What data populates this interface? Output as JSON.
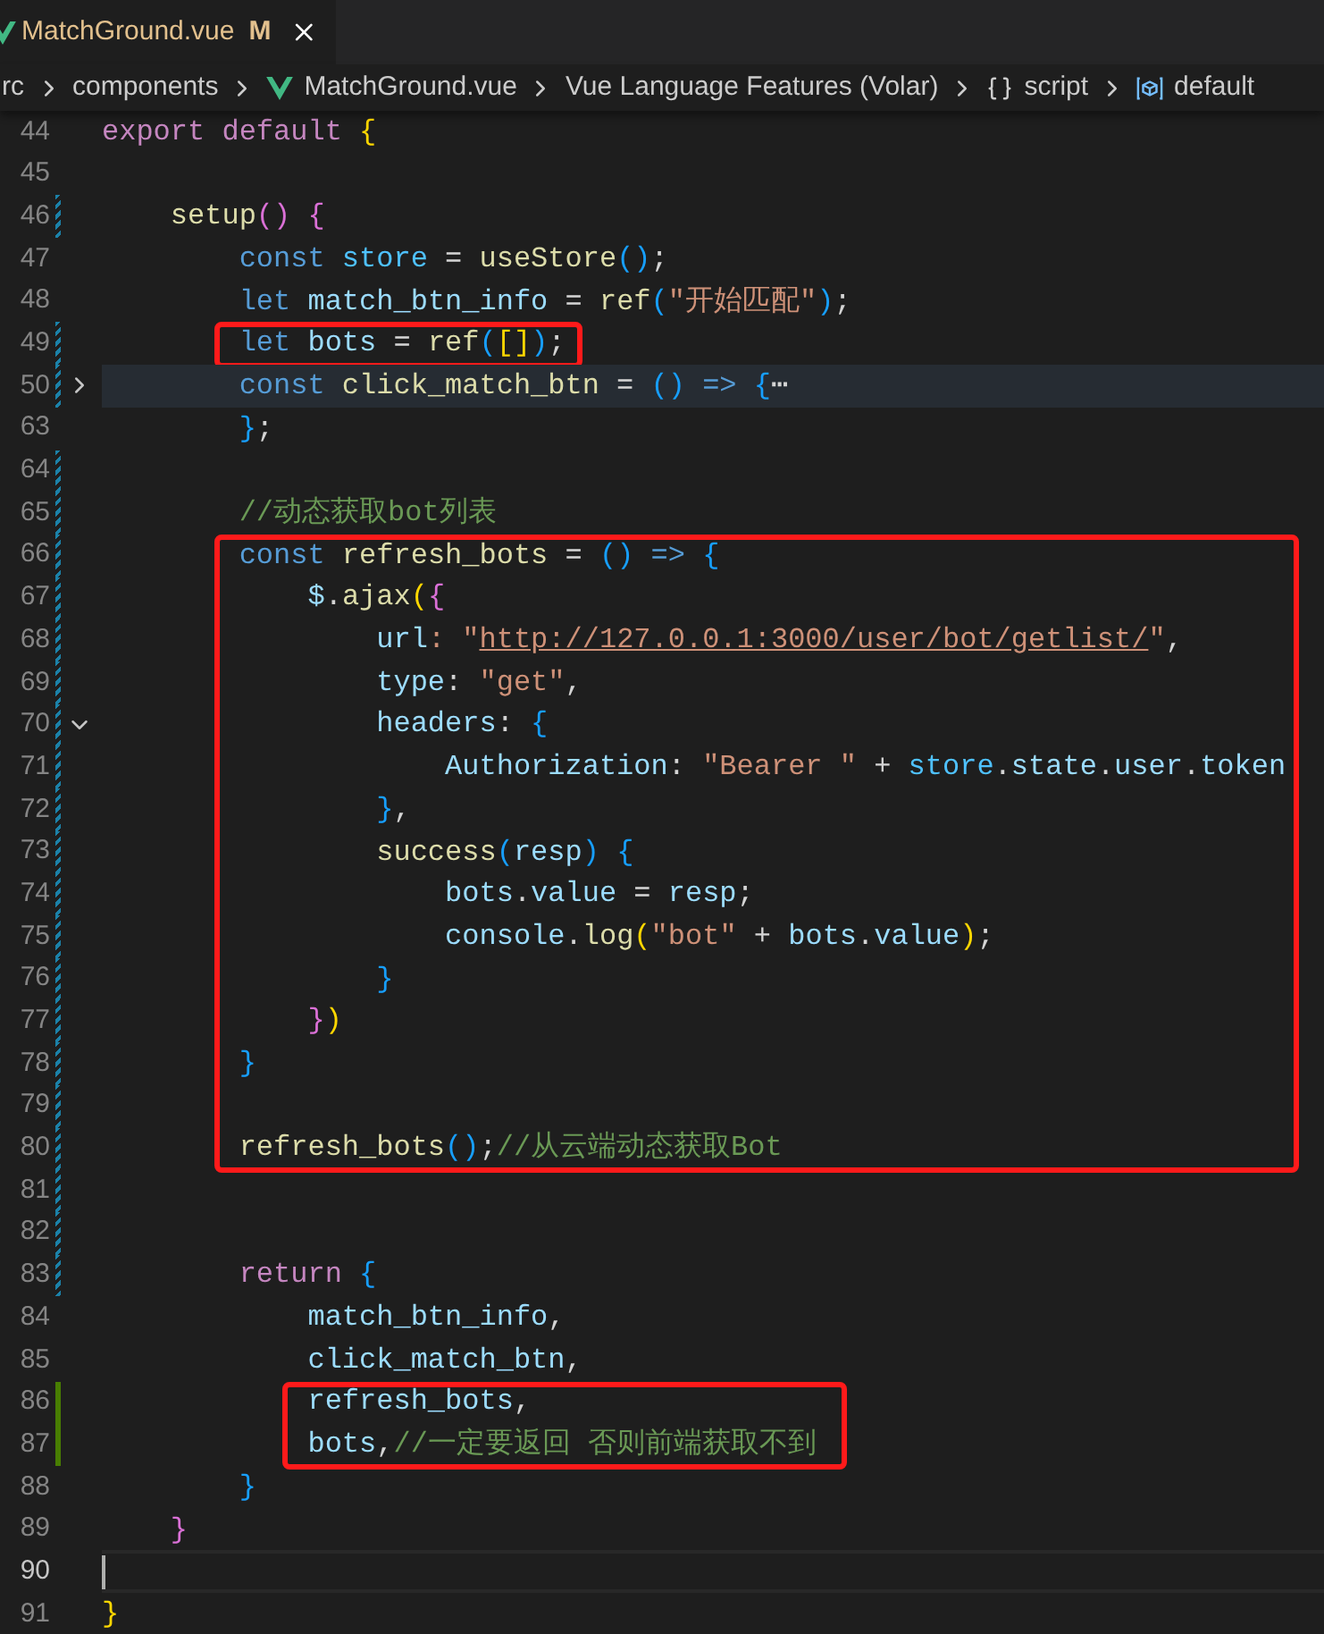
{
  "tab": {
    "filename": "MatchGround.vue",
    "status": "M"
  },
  "breadcrumbs": [
    {
      "label": "rc",
      "kind": "folder"
    },
    {
      "label": "components",
      "kind": "folder"
    },
    {
      "label": "MatchGround.vue",
      "kind": "vue"
    },
    {
      "label": "Vue Language Features (Volar)",
      "kind": "plain"
    },
    {
      "label": "script",
      "kind": "braces"
    },
    {
      "label": "default",
      "kind": "module"
    }
  ],
  "blocks": [
    {
      "boxed": false,
      "lines": [
        {
          "number": "44",
          "current": false,
          "kind": "plain",
          "tokens": [
            {
              "text": "export default ",
              "kind": "ctrl"
            },
            {
              "text": "{",
              "kind": "b1"
            }
          ]
        },
        {
          "number": "45",
          "current": false,
          "kind": "plain"
        },
        {
          "number": "46",
          "current": false,
          "kind": "modified",
          "tokens": [
            {
              "text": "    setup",
              "kind": "fn"
            },
            {
              "text": "()",
              "kind": "b2"
            },
            {
              "text": " {",
              "kind": "b2"
            }
          ]
        },
        {
          "number": "47",
          "current": false,
          "kind": "plain",
          "tokens": [
            {
              "text": "        const",
              "kind": "kw"
            },
            {
              "text": " store",
              "kind": "const"
            },
            {
              "text": " = ",
              "kind": "plain"
            },
            {
              "text": "useStore",
              "kind": "fn"
            },
            {
              "text": "()",
              "kind": "b3"
            },
            {
              "text": ";",
              "kind": "plain"
            }
          ]
        },
        {
          "number": "48",
          "current": false,
          "kind": "plain",
          "tokens": [
            {
              "text": "        let",
              "kind": "kw"
            },
            {
              "text": " match_btn_info",
              "kind": "var"
            },
            {
              "text": " = ",
              "kind": "plain"
            },
            {
              "text": "ref",
              "kind": "fn"
            },
            {
              "text": "(",
              "kind": "b3"
            },
            {
              "text": "\"开始匹配\"",
              "kind": "str"
            },
            {
              "text": ")",
              "kind": "b3"
            },
            {
              "text": ";",
              "kind": "plain"
            }
          ]
        }
      ]
    },
    {
      "boxed": true,
      "lines": [
        {
          "number": "49",
          "current": false,
          "kind": "modified",
          "tokens": [
            {
              "text": "        let",
              "kind": "kw"
            },
            {
              "text": " bots",
              "kind": "var"
            },
            {
              "text": " = ",
              "kind": "plain"
            },
            {
              "text": "ref",
              "kind": "fn"
            },
            {
              "text": "(",
              "kind": "b3"
            },
            {
              "text": "[]",
              "kind": "b1"
            },
            {
              "text": ")",
              "kind": "b3"
            },
            {
              "text": ";",
              "kind": "plain"
            }
          ]
        }
      ]
    },
    {
      "boxed": false,
      "lines": [
        {
          "number": "50",
          "current": false,
          "kind": "modified",
          "fold_marker": {
            "collapsed": true
          },
          "tokens": [
            {
              "text": "        const",
              "kind": "kw"
            },
            {
              "text": " click_match_btn",
              "kind": "fn"
            },
            {
              "text": " = ",
              "kind": "plain"
            },
            {
              "text": "()",
              "kind": "b3"
            },
            {
              "text": " =>",
              "kind": "kw"
            },
            {
              "text": " {",
              "kind": "b3"
            },
            {
              "text": "⋯",
              "kind": "plain"
            }
          ]
        },
        {
          "number": "63",
          "current": false,
          "kind": "plain",
          "tokens": [
            {
              "text": "        }",
              "kind": "b3"
            },
            {
              "text": ";",
              "kind": "plain"
            }
          ]
        },
        {
          "number": "64",
          "current": false,
          "kind": "modified"
        },
        {
          "number": "65",
          "current": false,
          "kind": "modified",
          "tokens": [
            {
              "text": "        //动态获取bot列表",
              "kind": "comment"
            }
          ]
        }
      ]
    },
    {
      "boxed": true,
      "lines": [
        {
          "number": "66",
          "current": false,
          "kind": "modified",
          "tokens": [
            {
              "text": "        const",
              "kind": "kw"
            },
            {
              "text": " refresh_bots",
              "kind": "fn"
            },
            {
              "text": " = ",
              "kind": "plain"
            },
            {
              "text": "()",
              "kind": "b3"
            },
            {
              "text": " =>",
              "kind": "kw"
            },
            {
              "text": " {",
              "kind": "b3"
            }
          ]
        },
        {
          "number": "67",
          "current": false,
          "kind": "modified",
          "tokens": [
            {
              "text": "            $",
              "kind": "var"
            },
            {
              "text": ".",
              "kind": "plain"
            },
            {
              "text": "ajax",
              "kind": "fn"
            },
            {
              "text": "(",
              "kind": "b1"
            },
            {
              "text": "{",
              "kind": "b2"
            }
          ]
        },
        {
          "number": "68",
          "current": false,
          "kind": "modified",
          "tokens": [
            {
              "text": "                url",
              "kind": "var"
            },
            {
              "text": ": \"",
              "kind": "str"
            },
            {
              "text": "http://127.0.0.1:3000/user/bot/getlist/",
              "kind": "url"
            },
            {
              "text": "\"",
              "kind": "str"
            },
            {
              "text": ",",
              "kind": "plain"
            }
          ]
        },
        {
          "number": "69",
          "current": false,
          "kind": "modified",
          "tokens": [
            {
              "text": "                type",
              "kind": "var"
            },
            {
              "text": ": ",
              "kind": "plain"
            },
            {
              "text": "\"get\"",
              "kind": "str"
            },
            {
              "text": ",",
              "kind": "plain"
            }
          ]
        },
        {
          "number": "70",
          "current": false,
          "kind": "modified",
          "fold_marker": {
            "collapsed": false
          },
          "tokens": [
            {
              "text": "                headers",
              "kind": "var"
            },
            {
              "text": ": ",
              "kind": "plain"
            },
            {
              "text": "{",
              "kind": "b3"
            }
          ]
        },
        {
          "number": "71",
          "current": false,
          "kind": "modified",
          "tokens": [
            {
              "text": "                    Authorization",
              "kind": "var"
            },
            {
              "text": ": ",
              "kind": "plain"
            },
            {
              "text": "\"Bearer \"",
              "kind": "str"
            },
            {
              "text": " + ",
              "kind": "plain"
            },
            {
              "text": "store",
              "kind": "const"
            },
            {
              "text": ".",
              "kind": "plain"
            },
            {
              "text": "state",
              "kind": "var"
            },
            {
              "text": ".",
              "kind": "plain"
            },
            {
              "text": "user",
              "kind": "var"
            },
            {
              "text": ".",
              "kind": "plain"
            },
            {
              "text": "token",
              "kind": "var"
            }
          ]
        },
        {
          "number": "72",
          "current": false,
          "kind": "modified",
          "tokens": [
            {
              "text": "                }",
              "kind": "b3"
            },
            {
              "text": ",",
              "kind": "plain"
            }
          ]
        },
        {
          "number": "73",
          "current": false,
          "kind": "modified",
          "tokens": [
            {
              "text": "                success",
              "kind": "fn"
            },
            {
              "text": "(",
              "kind": "b3"
            },
            {
              "text": "resp",
              "kind": "var"
            },
            {
              "text": ")",
              "kind": "b3"
            },
            {
              "text": " {",
              "kind": "b3"
            }
          ]
        },
        {
          "number": "74",
          "current": false,
          "kind": "modified",
          "tokens": [
            {
              "text": "                    bots",
              "kind": "var"
            },
            {
              "text": ".",
              "kind": "plain"
            },
            {
              "text": "value",
              "kind": "var"
            },
            {
              "text": " = ",
              "kind": "plain"
            },
            {
              "text": "resp",
              "kind": "var"
            },
            {
              "text": ";",
              "kind": "plain"
            }
          ]
        },
        {
          "number": "75",
          "current": false,
          "kind": "modified",
          "tokens": [
            {
              "text": "                    console",
              "kind": "var"
            },
            {
              "text": ".",
              "kind": "plain"
            },
            {
              "text": "log",
              "kind": "fn"
            },
            {
              "text": "(",
              "kind": "b1"
            },
            {
              "text": "\"bot\"",
              "kind": "str"
            },
            {
              "text": " + ",
              "kind": "plain"
            },
            {
              "text": "bots",
              "kind": "var"
            },
            {
              "text": ".",
              "kind": "plain"
            },
            {
              "text": "value",
              "kind": "var"
            },
            {
              "text": ")",
              "kind": "b1"
            },
            {
              "text": ";",
              "kind": "plain"
            }
          ]
        },
        {
          "number": "76",
          "current": false,
          "kind": "modified",
          "tokens": [
            {
              "text": "                }",
              "kind": "b3"
            }
          ]
        },
        {
          "number": "77",
          "current": false,
          "kind": "modified",
          "tokens": [
            {
              "text": "            }",
              "kind": "b2"
            },
            {
              "text": ")",
              "kind": "b1"
            }
          ]
        },
        {
          "number": "78",
          "current": false,
          "kind": "modified",
          "tokens": [
            {
              "text": "        }",
              "kind": "b3"
            }
          ]
        },
        {
          "number": "79",
          "current": false,
          "kind": "modified"
        },
        {
          "number": "80",
          "current": false,
          "kind": "modified",
          "tokens": [
            {
              "text": "        refresh_bots",
              "kind": "fn"
            },
            {
              "text": "()",
              "kind": "b3"
            },
            {
              "text": ";",
              "kind": "plain"
            },
            {
              "text": "//从云端动态获取Bot",
              "kind": "comment"
            }
          ]
        }
      ]
    },
    {
      "boxed": false,
      "lines": [
        {
          "number": "81",
          "current": false,
          "kind": "modified"
        },
        {
          "number": "82",
          "current": false,
          "kind": "modified"
        },
        {
          "number": "83",
          "current": false,
          "kind": "modified",
          "tokens": [
            {
              "text": "        return",
              "kind": "ctrl"
            },
            {
              "text": " {",
              "kind": "b3"
            }
          ]
        },
        {
          "number": "84",
          "current": false,
          "kind": "plain",
          "tokens": [
            {
              "text": "            match_btn_info",
              "kind": "var"
            },
            {
              "text": ",",
              "kind": "plain"
            }
          ]
        },
        {
          "number": "85",
          "current": false,
          "kind": "plain",
          "tokens": [
            {
              "text": "            click_match_btn",
              "kind": "var"
            },
            {
              "text": ",",
              "kind": "plain"
            }
          ]
        }
      ]
    },
    {
      "boxed": true,
      "lines": [
        {
          "number": "86",
          "current": false,
          "kind": "added",
          "tokens": [
            {
              "text": "            refresh_bots",
              "kind": "var"
            },
            {
              "text": ",",
              "kind": "plain"
            }
          ]
        },
        {
          "number": "87",
          "current": false,
          "kind": "added",
          "tokens": [
            {
              "text": "            bots",
              "kind": "var"
            },
            {
              "text": ",",
              "kind": "plain"
            },
            {
              "text": "//一定要返回 否则前端获取不到",
              "kind": "comment"
            }
          ]
        }
      ]
    },
    {
      "boxed": false,
      "lines": [
        {
          "number": "88",
          "current": false,
          "kind": "plain",
          "tokens": [
            {
              "text": "        }",
              "kind": "b3"
            }
          ]
        },
        {
          "number": "89",
          "current": false,
          "kind": "plain",
          "tokens": [
            {
              "text": "    }",
              "kind": "b2"
            }
          ]
        },
        {
          "number": "90",
          "current": true,
          "kind": "plain"
        },
        {
          "number": "91",
          "current": false,
          "kind": "plain",
          "tokens": [
            {
              "text": "}",
              "kind": "b1"
            }
          ]
        }
      ]
    }
  ]
}
